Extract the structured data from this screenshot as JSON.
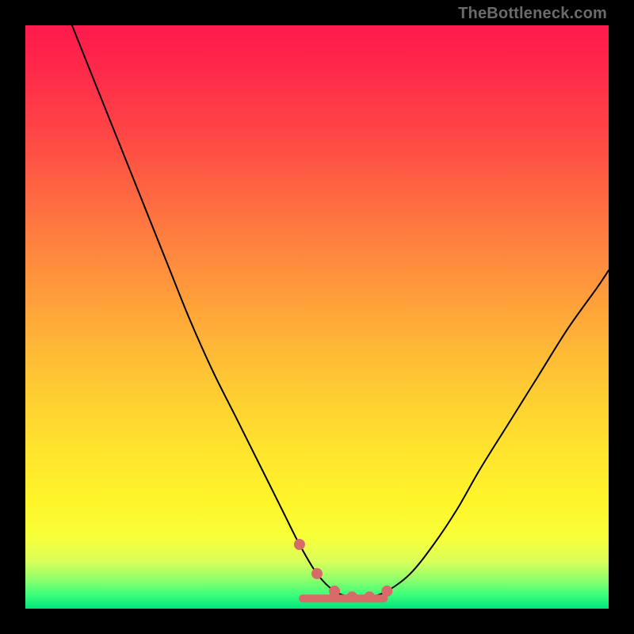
{
  "attribution": "TheBottleneck.com",
  "colors": {
    "background": "#000000",
    "gradient_top": "#ff1a4d",
    "gradient_mid": "#ffe22e",
    "gradient_bottom": "#00e57c",
    "curve": "#000000",
    "markers": "#d86a6a"
  },
  "chart_data": {
    "type": "line",
    "title": "",
    "xlabel": "",
    "ylabel": "",
    "xlim": [
      0,
      100
    ],
    "ylim": [
      0,
      100
    ],
    "grid": false,
    "legend": false,
    "series": [
      {
        "name": "bottleneck-curve",
        "x": [
          8,
          12,
          16,
          20,
          24,
          28,
          32,
          36,
          40,
          44,
          47,
          50,
          53,
          56,
          59,
          62,
          66,
          70,
          74,
          78,
          83,
          88,
          93,
          98,
          100
        ],
        "y": [
          100,
          90,
          80,
          70,
          60,
          50,
          41,
          33,
          25,
          17,
          11,
          6,
          3,
          2,
          2,
          3,
          6,
          11,
          17,
          24,
          32,
          40,
          48,
          55,
          58
        ]
      }
    ],
    "annotations": {
      "plateau_markers_x": [
        47,
        50,
        53,
        56,
        59,
        62
      ],
      "plateau_markers_y": [
        11,
        6,
        3,
        2,
        2,
        3
      ]
    },
    "background_gradient": {
      "orientation": "vertical",
      "stops": [
        {
          "pos": 0.0,
          "color": "#ff1a4d"
        },
        {
          "pos": 0.35,
          "color": "#ff7a40"
        },
        {
          "pos": 0.72,
          "color": "#ffe22e"
        },
        {
          "pos": 0.95,
          "color": "#8fff6a"
        },
        {
          "pos": 1.0,
          "color": "#00e57c"
        }
      ]
    }
  }
}
